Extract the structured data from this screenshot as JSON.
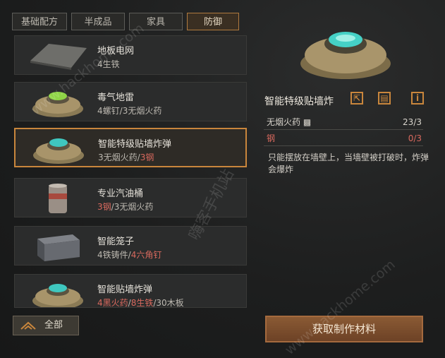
{
  "tabs": [
    {
      "label": "基础配方"
    },
    {
      "label": "半成品"
    },
    {
      "label": "家具"
    },
    {
      "label": "防御"
    }
  ],
  "items": [
    {
      "name": "地板电网",
      "req": [
        {
          "text": "4生铁",
          "red": false
        }
      ]
    },
    {
      "name": "毒气地雷",
      "req": [
        {
          "text": "4螺钉",
          "red": false
        },
        {
          "text": "/",
          "red": false
        },
        {
          "text": "3无烟火药",
          "red": false
        }
      ]
    },
    {
      "name": "智能特级贴墙炸弹",
      "req": [
        {
          "text": "3无烟火药",
          "red": false
        },
        {
          "text": "/",
          "red": false
        },
        {
          "text": "3钢",
          "red": true
        }
      ]
    },
    {
      "name": "专业汽油桶",
      "req": [
        {
          "text": "3钢",
          "red": true
        },
        {
          "text": "/",
          "red": false
        },
        {
          "text": "3无烟火药",
          "red": false
        }
      ]
    },
    {
      "name": "智能笼子",
      "req": [
        {
          "text": "4铁铸件",
          "red": false
        },
        {
          "text": "/",
          "red": false
        },
        {
          "text": "4六角钉",
          "red": true
        }
      ]
    },
    {
      "name": "智能贴墙炸弹",
      "req": [
        {
          "text": "4黑火药",
          "red": true
        },
        {
          "text": "/",
          "red": false
        },
        {
          "text": "8生铁",
          "red": true
        },
        {
          "text": "/",
          "red": false
        },
        {
          "text": "30木板",
          "red": false
        }
      ]
    }
  ],
  "detail": {
    "title": "智能特级贴墙炸",
    "buttons": [
      {
        "icon": "share-icon",
        "glyph": "⇱"
      },
      {
        "icon": "storage-icon",
        "glyph": "▤"
      },
      {
        "icon": "info-icon",
        "glyph": "i"
      }
    ],
    "materials": [
      {
        "name": "无烟火药 ▩",
        "count": "23/3",
        "color": "#d8d4cc"
      },
      {
        "name": "钢",
        "count": "0/3",
        "color": "#d9695e"
      }
    ],
    "description": "只能摆放在墙壁上，当墙壁被打破时，炸弹会爆炸"
  },
  "all_button": {
    "label": "全部"
  },
  "get_button": {
    "label": "获取制作材料"
  },
  "watermarks": [
    {
      "text": "www.hackhome.com"
    },
    {
      "text": "嗨客手机站"
    },
    {
      "text": "www.hackhome.com"
    }
  ],
  "colors": {
    "accent": "#c9863c",
    "missing": "#d9695e"
  }
}
